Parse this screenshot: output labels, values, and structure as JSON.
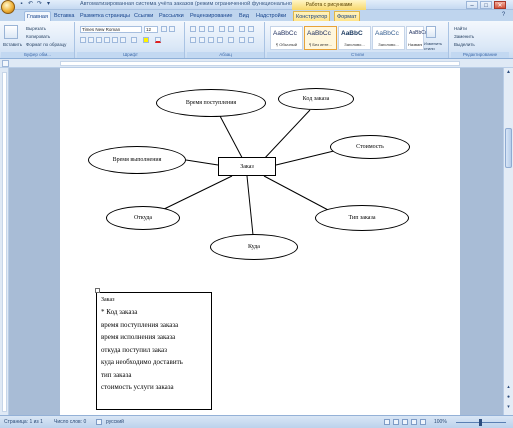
{
  "window": {
    "title": "Автоматизированная система учёта заказов (режим ограниченной функциональности) - Microsoft Word",
    "contextual_tab_group": "Работа с рисунками",
    "controls": {
      "minimize": "–",
      "maximize": "□",
      "close": "✕"
    }
  },
  "tabs": [
    "Главная",
    "Вставка",
    "Разметка страницы",
    "Ссылки",
    "Рассылки",
    "Рецензирование",
    "Вид",
    "Надстройки",
    "Конструктор",
    "Формат"
  ],
  "ribbon": {
    "clipboard": {
      "paste_label": "Вставить",
      "cut_label": "Вырезать",
      "copy_label": "Копировать",
      "format_painter_label": "Формат по образцу",
      "group_label": "Буфер обм..."
    },
    "font": {
      "font_name": "Times New Roman",
      "font_size": "12",
      "group_label": "Шрифт"
    },
    "paragraph": {
      "group_label": "Абзац"
    },
    "styles": {
      "items": [
        {
          "sample": "AaBbCc",
          "name": "¶ Обычный"
        },
        {
          "sample": "AaBbCc",
          "name": "¶ Без инте..."
        },
        {
          "sample": "AaBbC",
          "name": "Заголово..."
        },
        {
          "sample": "AaBbCc",
          "name": "Заголово..."
        },
        {
          "sample": "AaBbCc",
          "name": "Название"
        }
      ],
      "change_styles_label": "Изменить стили",
      "group_label": "Стили"
    },
    "editing": {
      "find_label": "Найти",
      "replace_label": "Заменить",
      "select_label": "Выделить",
      "group_label": "Редактирование"
    }
  },
  "diagram": {
    "center": "Заказ",
    "nodes": [
      {
        "id": "time-received",
        "label": "Время поступления"
      },
      {
        "id": "order-code",
        "label": "Код заказа"
      },
      {
        "id": "execution-time",
        "label": "Время выполнения"
      },
      {
        "id": "cost",
        "label": "Стоимость"
      },
      {
        "id": "from",
        "label": "Откуда"
      },
      {
        "id": "order-type",
        "label": "Тип заказа"
      },
      {
        "id": "to",
        "label": "Куда"
      }
    ]
  },
  "legend": {
    "title": "Заказ",
    "lines": [
      "* Код заказа",
      "время поступления заказа",
      "время исполнения заказа",
      "откуда поступил заказ",
      "куда необходимо доставить",
      "тип заказа",
      "стоимость услуги заказа"
    ]
  },
  "statusbar": {
    "page": "Страница: 1 из 1",
    "words": "Число слов: 0",
    "language": "русский",
    "zoom": "100%"
  }
}
